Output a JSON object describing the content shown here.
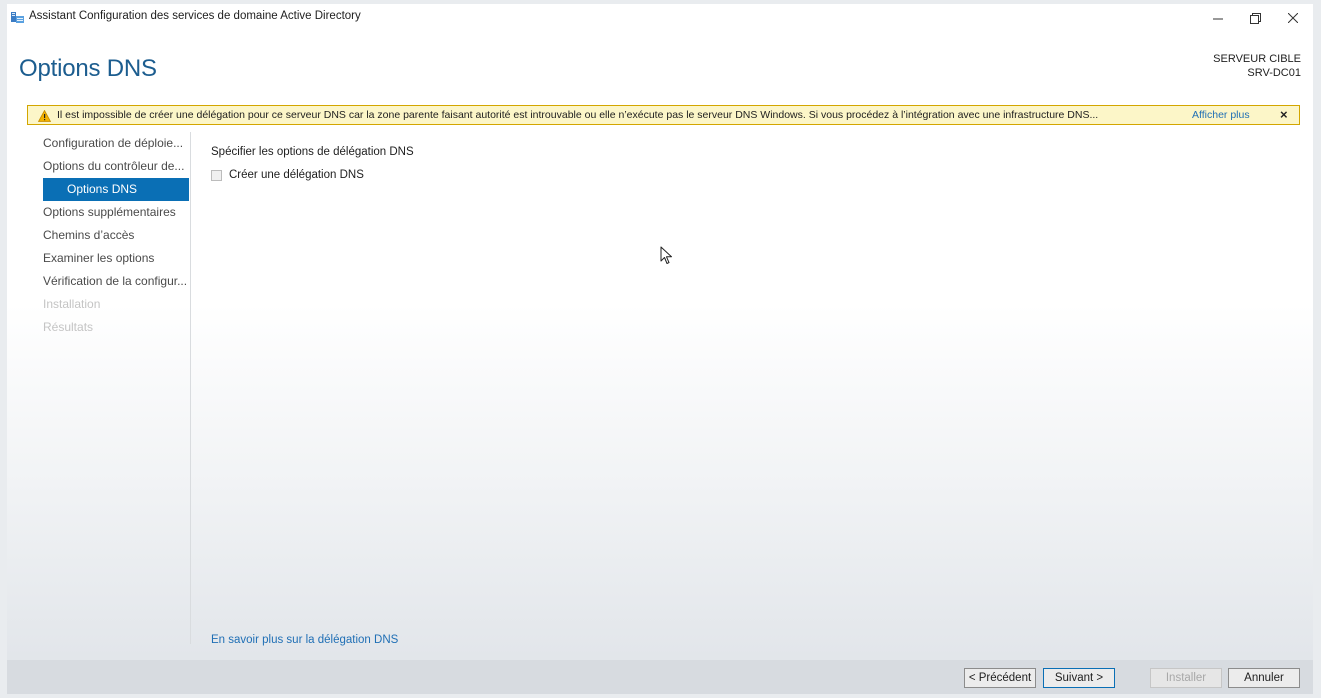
{
  "window": {
    "title": "Assistant Configuration des services de domaine Active Directory",
    "controls": {
      "minimize": "minimize-icon",
      "restore": "restore-icon",
      "close": "close-icon"
    }
  },
  "header": {
    "title": "Options DNS",
    "server_label": "SERVEUR CIBLE",
    "server_name": "SRV-DC01"
  },
  "warning": {
    "icon": "warning-icon",
    "text": "Il est impossible de créer une délégation pour ce serveur DNS car la zone parente faisant autorité est introuvable ou elle n’exécute pas le serveur DNS Windows. Si vous procédez à l’intégration avec une infrastructure DNS...",
    "more_link": "Afficher plus",
    "close": "×"
  },
  "sidebar": {
    "items": [
      {
        "label": "Configuration de déploie..."
      },
      {
        "label": "Options du contrôleur de..."
      },
      {
        "label": "Options DNS"
      },
      {
        "label": "Options supplémentaires"
      },
      {
        "label": "Chemins d’accès"
      },
      {
        "label": "Examiner les options"
      },
      {
        "label": "Vérification de la configur..."
      },
      {
        "label": "Installation"
      },
      {
        "label": "Résultats"
      }
    ]
  },
  "main": {
    "section_label": "Spécifier les options de délégation DNS",
    "checkbox_label": "Créer une délégation DNS",
    "checkbox_checked": false,
    "learn_more_link": "En savoir plus sur la délégation DNS"
  },
  "footer": {
    "previous": "< Précédent",
    "next": "Suivant >",
    "install": "Installer",
    "cancel": "Annuler"
  },
  "colors": {
    "accent": "#0a6fb5",
    "title": "#1c5d8f",
    "link": "#1f6fb5",
    "warning_bg": "#fcf6c8",
    "warning_border": "#d3a600"
  }
}
